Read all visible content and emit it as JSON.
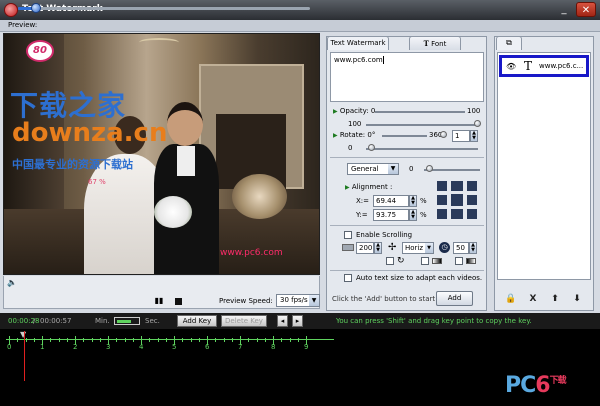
{
  "window": {
    "title": "Text Watermark",
    "minimize_glyph": "_",
    "close_glyph": "✕"
  },
  "preview_label": "Preview:",
  "image_overlay": {
    "logo_text": "80",
    "cn_big": "下载之家",
    "downza": "downza.cn",
    "cn_small": "中国最专业的资源下载站",
    "percent": "67 %",
    "pc6": "www.pc6.com"
  },
  "playback": {
    "speed_label": "Preview Speed:",
    "speed_value": "30 fps/s",
    "progress": 0.06
  },
  "middle_panel": {
    "tab_watermark": "Text Watermark",
    "tab_font": "Font",
    "text_value": "www.pc6.com",
    "opacity_label": "Opacity",
    "opacity_min": "0",
    "opacity_max": "100",
    "opacity_value": "100",
    "rotate_label": "Rotate",
    "rotate_min": "0°",
    "rotate_max": "360°",
    "rotate_step": "1",
    "rotate_value": "0",
    "general_option": "General",
    "general_value": "0",
    "alignment_label": "Alignment :",
    "x_label": "X:=",
    "x_value": "69.44",
    "y_label": "Y:=",
    "y_value": "93.75",
    "percent_sign": "%",
    "scrolling_label": "Enable Scrolling",
    "scroll_value1": "200",
    "scroll_direction": "Horiz",
    "scroll_value2": "50",
    "auto_text_label": "Auto text size to adapt each videos.",
    "add_hint": "Click the 'Add' button to start ->",
    "add_button": "Add"
  },
  "right_panel": {
    "item_name": "www.pc6.c...",
    "item_type_glyph": "T",
    "buttons": [
      "🔒",
      "X",
      "⬆",
      "⬇"
    ]
  },
  "timeline": {
    "time_current": "00:00:28",
    "time_separator": "/",
    "time_total": "00:00:57",
    "min_label": "Min.",
    "sec_label": "Sec.",
    "add_key": "Add Key",
    "delete_key": "Delete Key",
    "hint": "You can press 'Shift' and drag key point to copy the key.",
    "ruler_labels": [
      "0",
      "1",
      "2",
      "3",
      "4",
      "5",
      "6",
      "7",
      "8",
      "9"
    ]
  },
  "brand": {
    "pc": "PC",
    "six": "6",
    "suffix": "下载"
  }
}
